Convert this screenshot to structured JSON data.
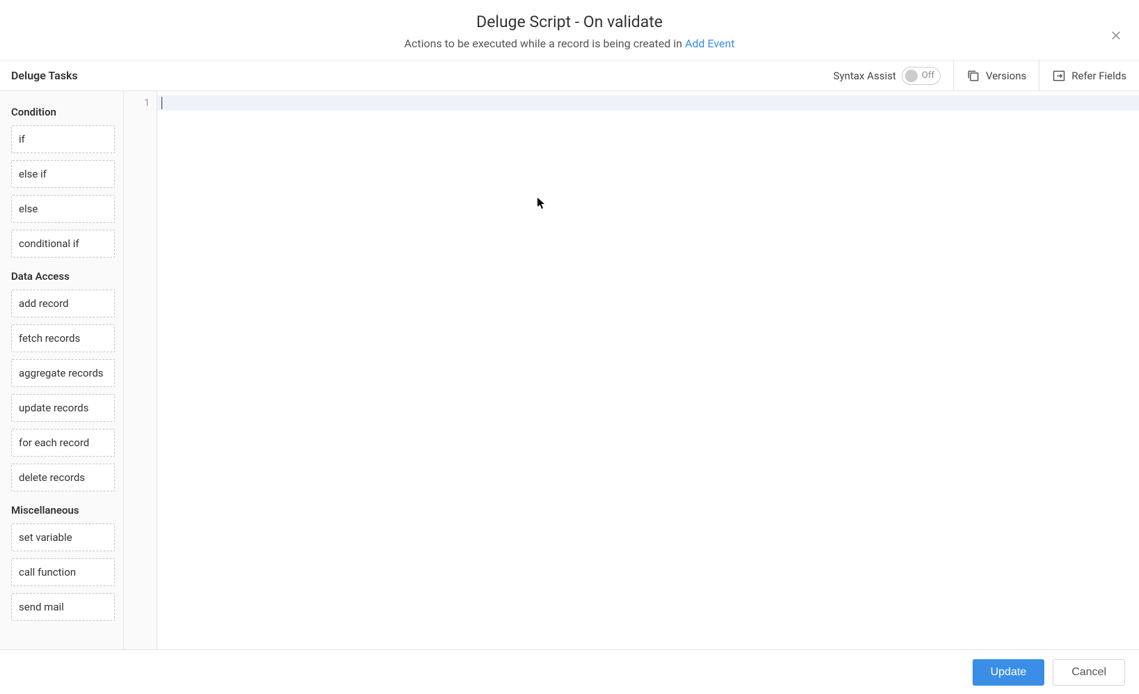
{
  "header": {
    "title": "Deluge Script - On validate",
    "subtitle_prefix": "Actions to be executed while a record is being created in ",
    "subtitle_link": "Add Event"
  },
  "sidebar": {
    "title": "Deluge Tasks",
    "groups": [
      {
        "title": "Condition",
        "items": [
          "if",
          "else if",
          "else",
          "conditional if"
        ]
      },
      {
        "title": "Data Access",
        "items": [
          "add record",
          "fetch records",
          "aggregate records",
          "update records",
          "for each record",
          "delete records"
        ]
      },
      {
        "title": "Miscellaneous",
        "items": [
          "set variable",
          "call function",
          "send mail"
        ]
      }
    ]
  },
  "toolbar": {
    "syntax_assist_label": "Syntax Assist",
    "syntax_assist_state": "Off",
    "versions_label": "Versions",
    "refer_fields_label": "Refer Fields"
  },
  "editor": {
    "lines": [
      "1"
    ]
  },
  "footer": {
    "update_label": "Update",
    "cancel_label": "Cancel"
  }
}
